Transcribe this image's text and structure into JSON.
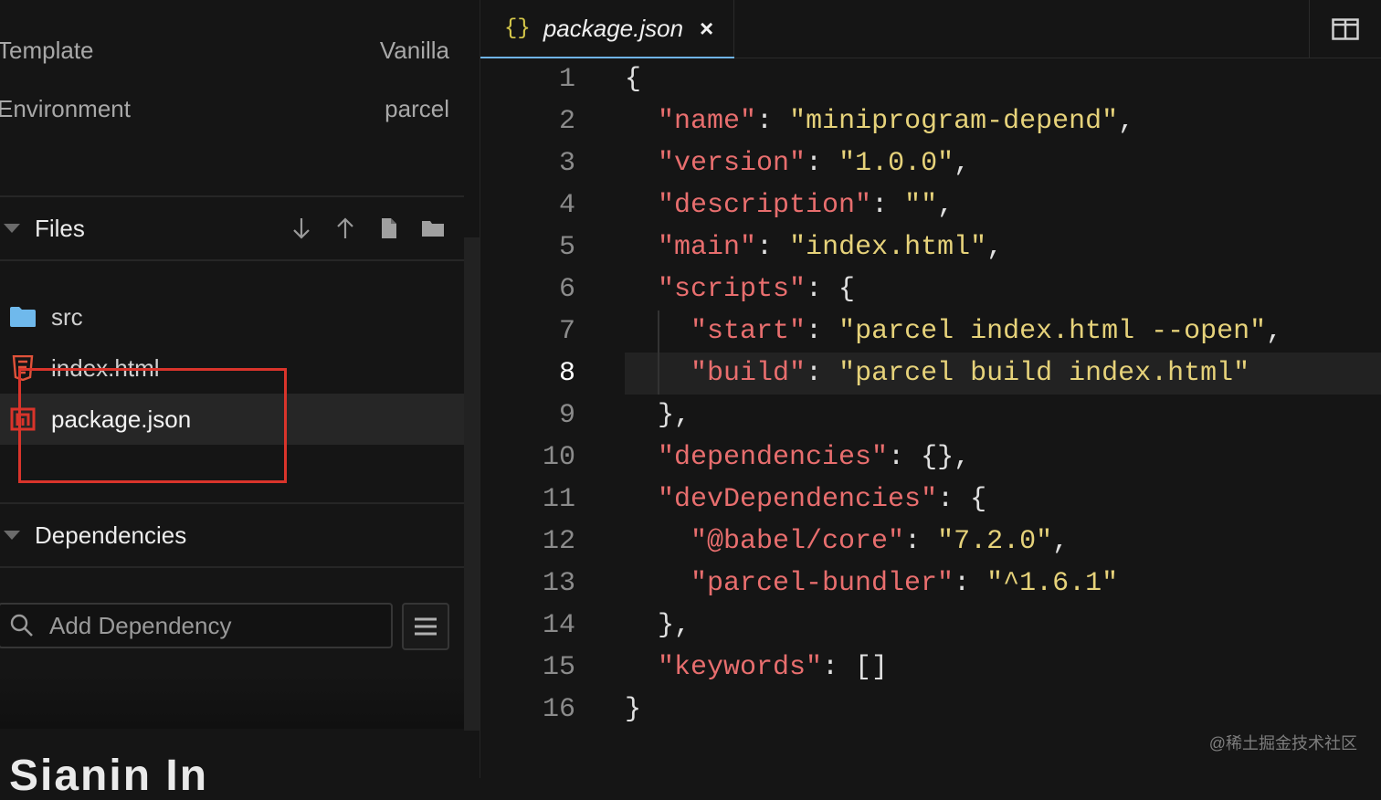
{
  "sidebar": {
    "meta": [
      {
        "label": "Template",
        "value": "Vanilla"
      },
      {
        "label": "Environment",
        "value": "parcel"
      }
    ],
    "files_section": {
      "title": "Files",
      "actions": [
        "download-icon",
        "upload-icon",
        "new-file-icon",
        "new-folder-icon"
      ],
      "items": [
        {
          "name": "src",
          "icon": "folder-icon"
        },
        {
          "name": "index.html",
          "icon": "html5-icon"
        },
        {
          "name": "package.json",
          "icon": "npm-icon",
          "active": true
        }
      ]
    },
    "dependencies_section": {
      "title": "Dependencies",
      "search_placeholder": "Add Dependency"
    },
    "partial_heading": "Sianin In"
  },
  "editor": {
    "tab": {
      "icon": "{}",
      "name": "package.json",
      "close": "×"
    },
    "current_line": 8,
    "lines": [
      {
        "n": "1",
        "segs": [
          [
            "p",
            "{"
          ]
        ]
      },
      {
        "n": "2",
        "segs": [
          [
            "p",
            "  "
          ],
          [
            "k",
            "\"name\""
          ],
          [
            "p",
            ": "
          ],
          [
            "s",
            "\"miniprogram-depend\""
          ],
          [
            "p",
            ","
          ]
        ]
      },
      {
        "n": "3",
        "segs": [
          [
            "p",
            "  "
          ],
          [
            "k",
            "\"version\""
          ],
          [
            "p",
            ": "
          ],
          [
            "s",
            "\"1.0.0\""
          ],
          [
            "p",
            ","
          ]
        ]
      },
      {
        "n": "4",
        "segs": [
          [
            "p",
            "  "
          ],
          [
            "k",
            "\"description\""
          ],
          [
            "p",
            ": "
          ],
          [
            "s",
            "\"\""
          ],
          [
            "p",
            ","
          ]
        ]
      },
      {
        "n": "5",
        "segs": [
          [
            "p",
            "  "
          ],
          [
            "k",
            "\"main\""
          ],
          [
            "p",
            ": "
          ],
          [
            "s",
            "\"index.html\""
          ],
          [
            "p",
            ","
          ]
        ]
      },
      {
        "n": "6",
        "segs": [
          [
            "p",
            "  "
          ],
          [
            "k",
            "\"scripts\""
          ],
          [
            "p",
            ": {"
          ]
        ]
      },
      {
        "n": "7",
        "segs": [
          [
            "p",
            "    "
          ],
          [
            "k",
            "\"start\""
          ],
          [
            "p",
            ": "
          ],
          [
            "s",
            "\"parcel index.html --open\""
          ],
          [
            "p",
            ","
          ]
        ]
      },
      {
        "n": "8",
        "segs": [
          [
            "p",
            "    "
          ],
          [
            "k",
            "\"build\""
          ],
          [
            "p",
            ": "
          ],
          [
            "s",
            "\"parcel build index.html\""
          ]
        ]
      },
      {
        "n": "9",
        "segs": [
          [
            "p",
            "  },"
          ]
        ]
      },
      {
        "n": "10",
        "segs": [
          [
            "p",
            "  "
          ],
          [
            "k",
            "\"dependencies\""
          ],
          [
            "p",
            ": {},"
          ]
        ]
      },
      {
        "n": "11",
        "segs": [
          [
            "p",
            "  "
          ],
          [
            "k",
            "\"devDependencies\""
          ],
          [
            "p",
            ": {"
          ]
        ]
      },
      {
        "n": "12",
        "segs": [
          [
            "p",
            "    "
          ],
          [
            "k",
            "\"@babel/core\""
          ],
          [
            "p",
            ": "
          ],
          [
            "s",
            "\"7.2.0\""
          ],
          [
            "p",
            ","
          ]
        ]
      },
      {
        "n": "13",
        "segs": [
          [
            "p",
            "    "
          ],
          [
            "k",
            "\"parcel-bundler\""
          ],
          [
            "p",
            ": "
          ],
          [
            "s",
            "\"^1.6.1\""
          ]
        ]
      },
      {
        "n": "14",
        "segs": [
          [
            "p",
            "  },"
          ]
        ]
      },
      {
        "n": "15",
        "segs": [
          [
            "p",
            "  "
          ],
          [
            "k",
            "\"keywords\""
          ],
          [
            "p",
            ": []"
          ]
        ]
      },
      {
        "n": "16",
        "segs": [
          [
            "p",
            "}"
          ]
        ]
      }
    ]
  },
  "watermark": "@稀土掘金技术社区",
  "colors": {
    "key": "#e86e6e",
    "string": "#e6d27a",
    "tab_underline": "#6fb3e8",
    "highlight_box": "#d9342b"
  }
}
